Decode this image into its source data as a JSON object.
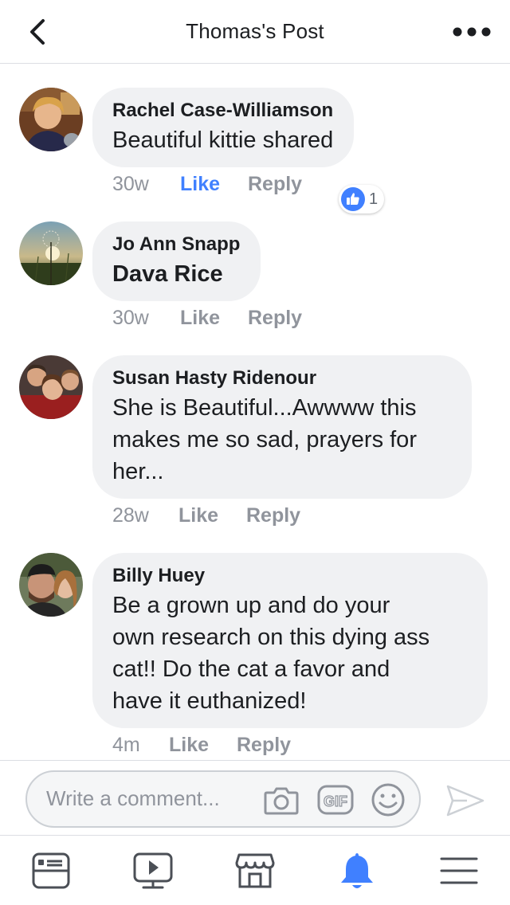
{
  "header": {
    "title": "Thomas's Post",
    "back_icon": "chevron-left-icon",
    "more_icon": "more-horizontal-icon"
  },
  "comments": [
    {
      "name": "Rachel Case-Williamson",
      "text": "Beautiful kittie shared",
      "time": "30w",
      "like_label": "Like",
      "reply_label": "Reply",
      "liked": true,
      "reactions": {
        "icon": "thumbs-up-icon",
        "count": "1"
      }
    },
    {
      "name": "Jo Ann Snapp",
      "text": "Dava Rice",
      "text_is_tag": true,
      "time": "30w",
      "like_label": "Like",
      "reply_label": "Reply"
    },
    {
      "name": "Susan Hasty Ridenour",
      "text_lines": [
        "She is Beautiful...Awwww this",
        "makes me so sad, prayers for",
        "her..."
      ],
      "time": "28w",
      "like_label": "Like",
      "reply_label": "Reply"
    },
    {
      "name": "Billy Huey",
      "text_lines": [
        "Be a grown up and do your",
        "own research on this dying ass",
        "cat!! Do the cat a favor and",
        "have it euthanized!"
      ],
      "time": "4m",
      "like_label": "Like",
      "reply_label": "Reply"
    }
  ],
  "composer": {
    "placeholder": "Write a comment...",
    "icons": [
      "camera-icon",
      "gif-icon",
      "emoji-icon",
      "send-icon"
    ],
    "gif_label": "GIF"
  },
  "tabbar": {
    "items": [
      "news-feed-icon",
      "watch-icon",
      "marketplace-icon",
      "notifications-icon",
      "menu-icon"
    ],
    "active": "notifications-icon"
  },
  "colors": {
    "accent": "#4080ff",
    "bubble": "#f0f1f3",
    "meta_text": "#90949c",
    "divider": "#dcdee3"
  }
}
